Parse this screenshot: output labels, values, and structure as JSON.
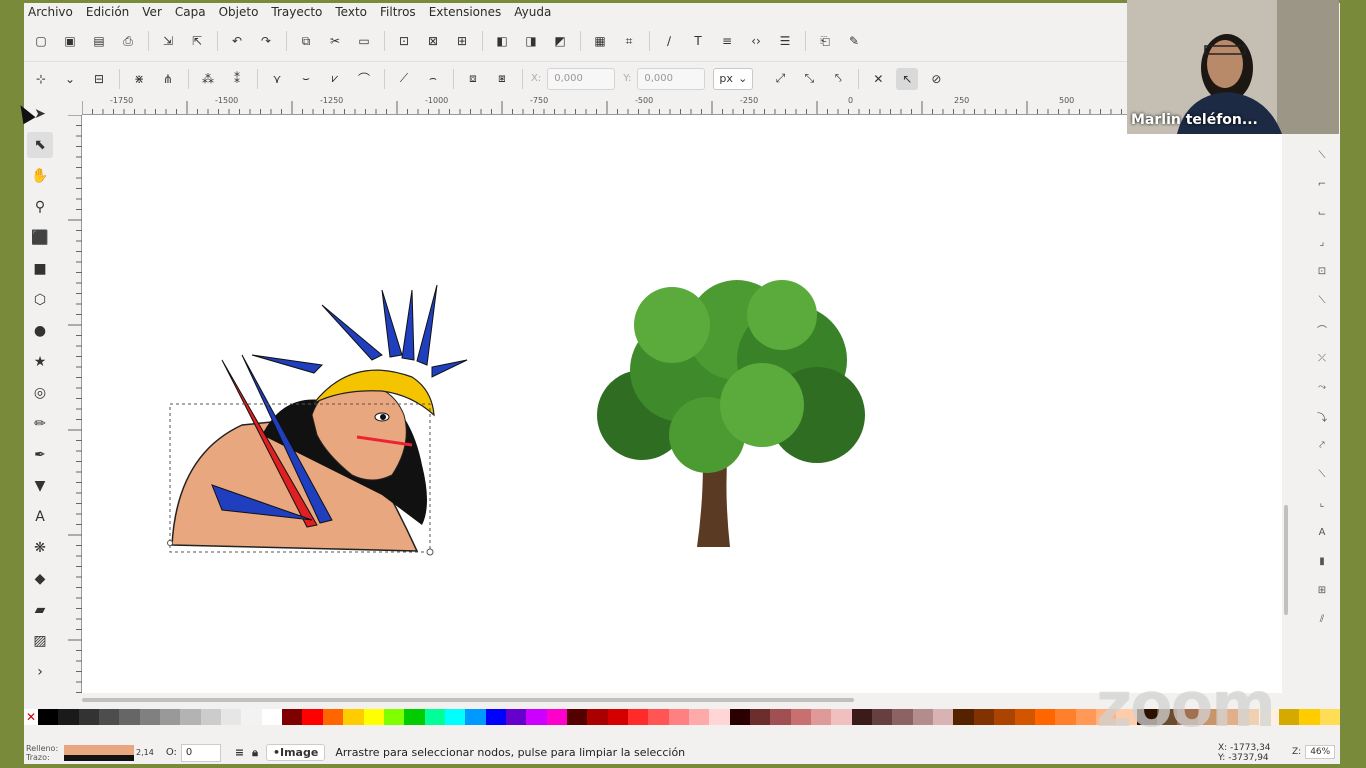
{
  "menu": [
    "Archivo",
    "Edición",
    "Ver",
    "Capa",
    "Objeto",
    "Trayecto",
    "Texto",
    "Filtros",
    "Extensiones",
    "Ayuda"
  ],
  "toolbar": {
    "x_label": "X:",
    "x_value": "0,000",
    "y_label": "Y:",
    "y_value": "0,000",
    "unit": "px"
  },
  "ruler": {
    "labels": [
      "-1750",
      "-1500",
      "-1250",
      "-1000",
      "-750",
      "-500",
      "-250",
      "0",
      "250",
      "500"
    ]
  },
  "status": {
    "fill_label": "Relleno:",
    "stroke_label": "Trazo:",
    "stroke_width": "2,14",
    "opacity_label": "O:",
    "opacity_value": "0",
    "layer": "•Image",
    "message": "Arrastre para seleccionar nodos, pulse para limpiar la selección",
    "x_coord": "X: -1773,34",
    "y_coord": "Y: -3737,94",
    "zoom_label": "Z:",
    "zoom_value": "46%"
  },
  "video": {
    "participant_name": "Marlin teléfon..."
  },
  "watermark": "zoom",
  "colors": {
    "fill": "#e8a77e",
    "stroke": "#111111",
    "palette": [
      "#000000",
      "#1a1a1a",
      "#333333",
      "#4d4d4d",
      "#666666",
      "#808080",
      "#999999",
      "#b3b3b3",
      "#cccccc",
      "#e6e6e6",
      "#f2f2f2",
      "#ffffff",
      "#800000",
      "#ff0000",
      "#ff6600",
      "#ffcc00",
      "#ffff00",
      "#80ff00",
      "#00cc00",
      "#00ff99",
      "#00ffff",
      "#0099ff",
      "#0000ff",
      "#6600cc",
      "#cc00ff",
      "#ff00cc",
      "#550000",
      "#aa0000",
      "#d40000",
      "#ff2a2a",
      "#ff5555",
      "#ff8080",
      "#ffaaaa",
      "#ffd5d5",
      "#2b0000",
      "#6c2d2d",
      "#a05050",
      "#c87070",
      "#e09999",
      "#f0c0c0",
      "#3b1a1a",
      "#664040",
      "#8c6262",
      "#b38c8c",
      "#d9b3b3",
      "#552200",
      "#803300",
      "#aa4400",
      "#d45500",
      "#ff6600",
      "#ff7f2a",
      "#ff9955",
      "#ffb380",
      "#ffccaa",
      "#2b1100",
      "#6c4a2d",
      "#a07050",
      "#c8956b",
      "#e0b08a",
      "#f0d0b0",
      "#fff0e0",
      "#d4aa00",
      "#ffcc00",
      "#ffdd55"
    ]
  }
}
